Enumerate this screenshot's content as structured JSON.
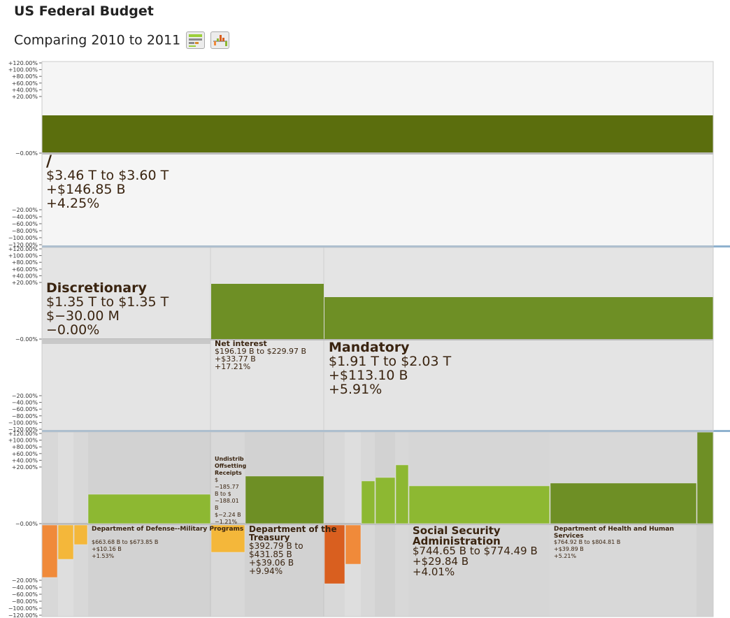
{
  "header": {
    "title": "US Federal Budget",
    "subtitle": "Comparing 2010 to 2011",
    "table_view_icon": "table-view-icon",
    "chart_view_icon": "chart-view-icon"
  },
  "axis_ticks": [
    "+120.00%",
    "+100.00%",
    "+80.00%",
    "+60.00%",
    "+40.00%",
    "+20.00%",
    "−0.00%",
    "−20.00%",
    "−40.00%",
    "−60.00%",
    "−80.00%",
    "−100.00%",
    "−120.00%"
  ],
  "colors": {
    "panel_bg_light": "#f5f5f5",
    "panel_bg": "#e4e4e4",
    "dark_green": "#5b6e0d",
    "mid_green": "#6e8f25",
    "light_green": "#8db832",
    "orange_dark": "#d95f1f",
    "orange": "#f08a3a",
    "yellow_orange": "#f4b73a",
    "separator": "#8fb2cf"
  },
  "chart_data": [
    {
      "type": "bar",
      "level": 0,
      "ylim": [
        -120,
        120
      ],
      "items": [
        {
          "name": "/",
          "value_pct": 4.25,
          "range": "$3.46 T to $3.60 T",
          "change": "+$146.85 B",
          "pct": "+4.25%"
        }
      ]
    },
    {
      "type": "bar",
      "level": 1,
      "ylim": [
        -120,
        120
      ],
      "items": [
        {
          "name": "Discretionary",
          "value_pct": -0.0,
          "range": "$1.35 T to $1.35 T",
          "change": "$−30.00 M",
          "pct": "−0.00%"
        },
        {
          "name": "Net interest",
          "value_pct": 17.21,
          "range": "$196.19 B to $229.97 B",
          "change": "+$33.77 B",
          "pct": "+17.21%"
        },
        {
          "name": "Mandatory",
          "value_pct": 5.91,
          "range": "$1.91 T to $2.03 T",
          "change": "+$113.10 B",
          "pct": "+5.91%"
        }
      ]
    },
    {
      "type": "bar",
      "level": 2,
      "ylim": [
        -120,
        120
      ],
      "labeled_items": [
        {
          "name": "Department of Defense--Military Programs",
          "value_pct": 1.53,
          "range": "$663.68 B to $673.85 B",
          "change": "+$10.16 B",
          "pct": "+1.53%"
        },
        {
          "name": "Undistributed Offsetting Receipts",
          "name_visible": "Undistrib Offsetting Receipts",
          "range_visible": [
            "$",
            "−185.77",
            "B to $",
            "−188.01",
            "B",
            "$−2.24 B",
            "−1.21%"
          ]
        },
        {
          "name": "Department of the Treasury",
          "value_pct": 9.94,
          "range": "$392.79 B to $431.85 B",
          "change": "+$39.06 B",
          "pct": "+9.94%"
        },
        {
          "name": "Social Security Administration",
          "value_pct": 4.01,
          "range": "$744.65 B to $774.49 B",
          "change": "+$29.84 B",
          "pct": "+4.01%"
        },
        {
          "name": "Department of Health and Human Services",
          "value_pct": 5.21,
          "range": "$764.92 B to $804.81 B",
          "change": "+$39.89 B",
          "pct": "+5.21%"
        }
      ]
    }
  ]
}
